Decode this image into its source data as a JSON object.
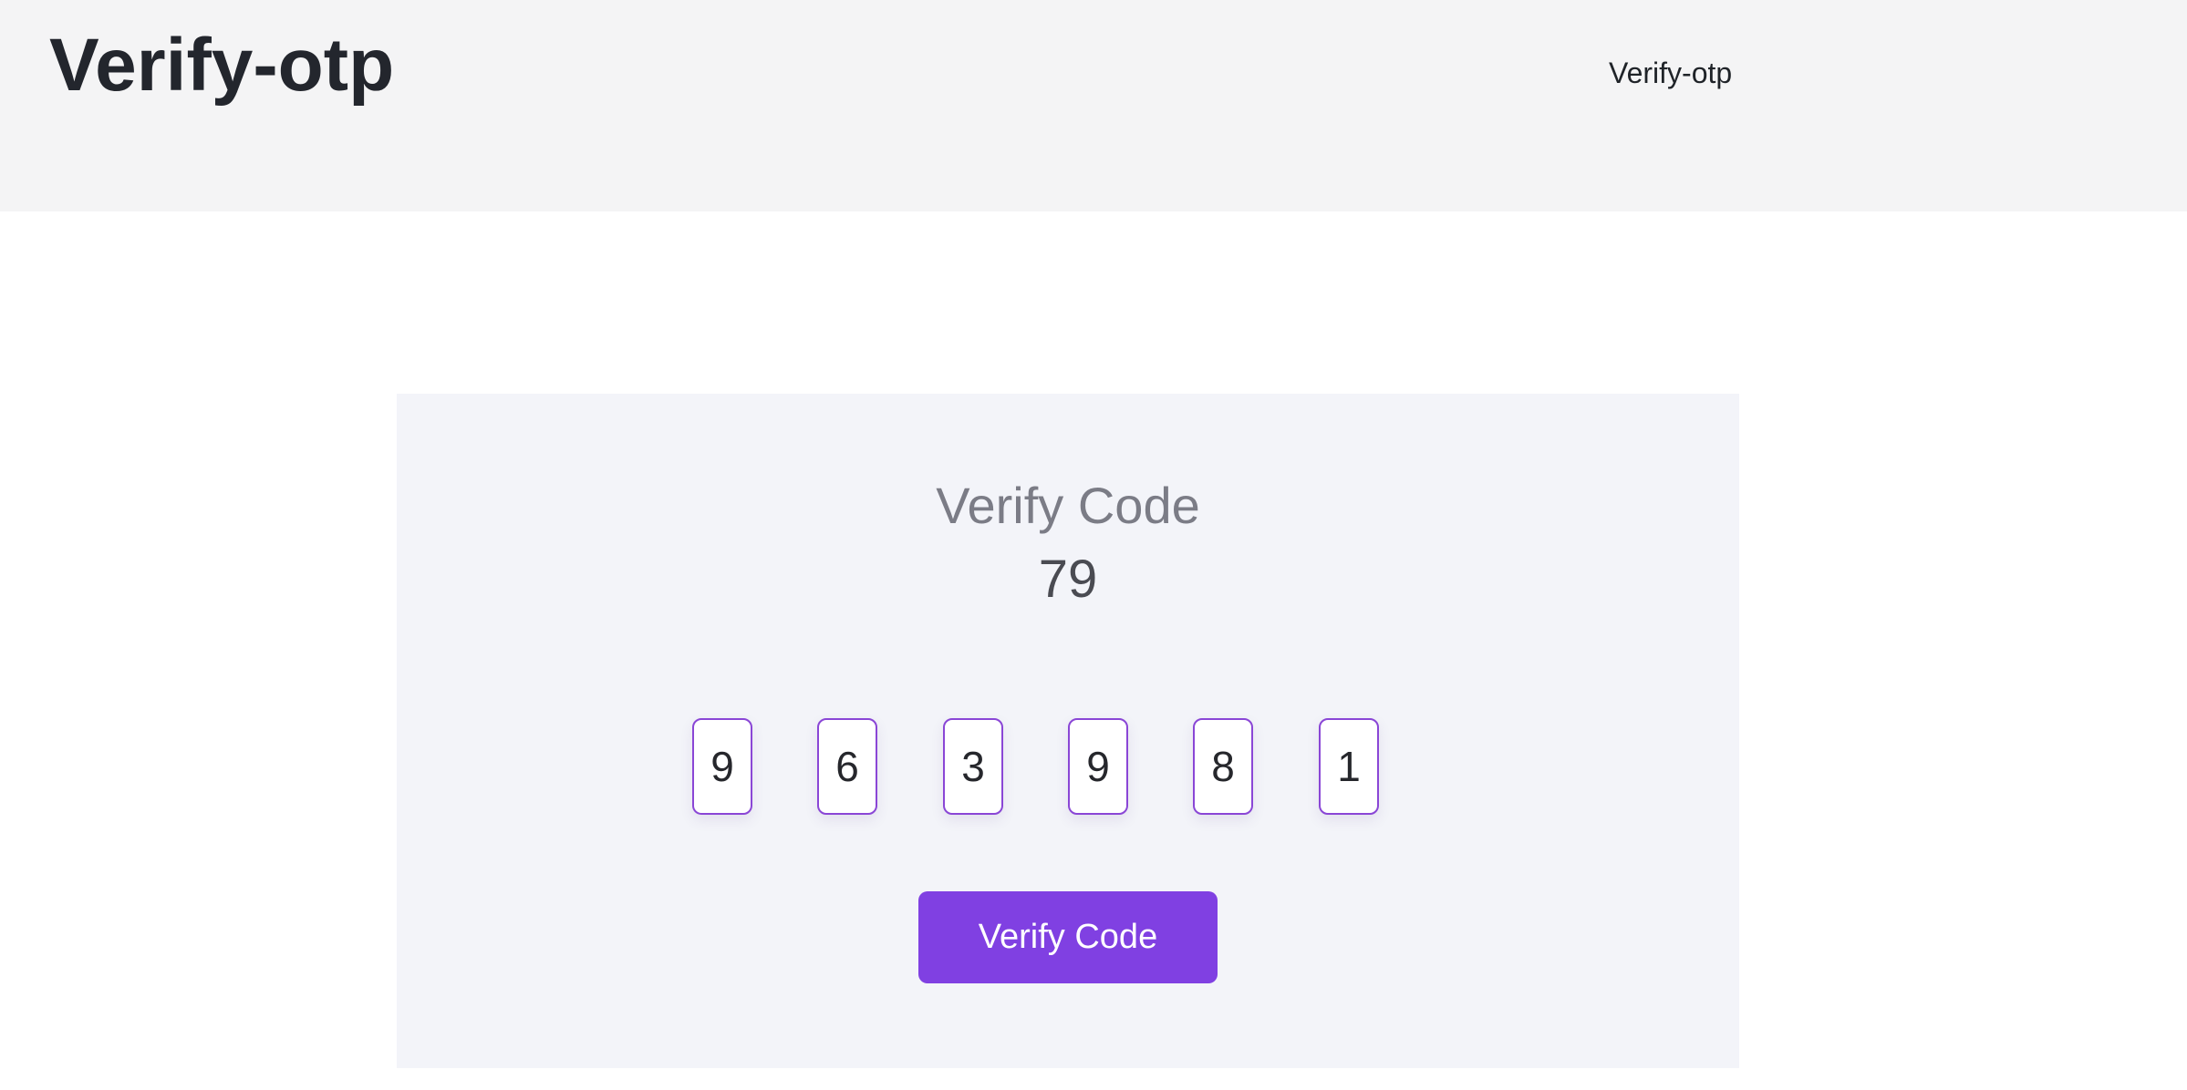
{
  "header": {
    "title": "Verify-otp",
    "breadcrumb": "Verify-otp"
  },
  "card": {
    "title": "Verify Code",
    "countdown": "79",
    "otp_digits": [
      "9",
      "6",
      "3",
      "9",
      "8",
      "1"
    ],
    "button_label": "Verify Code"
  },
  "colors": {
    "accent": "#8040e2",
    "otp_border": "#8a46d6",
    "header_bg": "#f4f4f5",
    "card_bg": "#f3f4f9"
  }
}
